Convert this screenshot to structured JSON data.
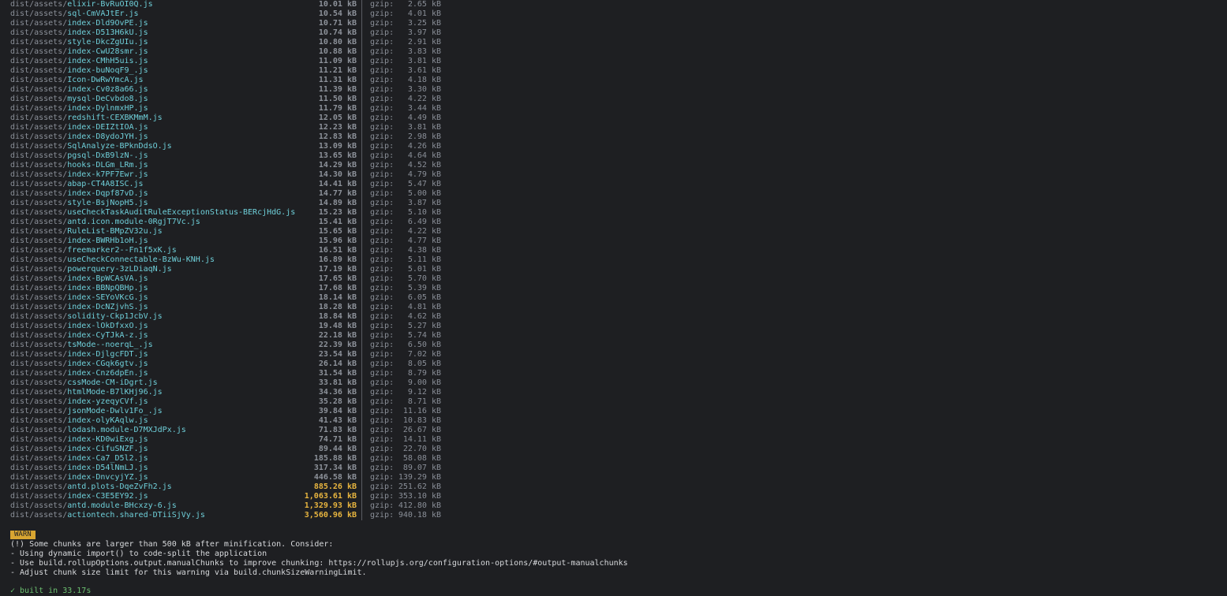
{
  "rows": [
    {
      "dir": "dist/assets/",
      "file": "elixir-BvRuOI0Q.js",
      "size": "10.01 kB",
      "gzip_label": "gzip:",
      "gzip": "2.65 kB"
    },
    {
      "dir": "dist/assets/",
      "file": "sql-CmVAJtEr.js",
      "size": "10.54 kB",
      "gzip_label": "gzip:",
      "gzip": "4.01 kB"
    },
    {
      "dir": "dist/assets/",
      "file": "index-Dld9OvPE.js",
      "size": "10.71 kB",
      "gzip_label": "gzip:",
      "gzip": "3.25 kB"
    },
    {
      "dir": "dist/assets/",
      "file": "index-D513H6kU.js",
      "size": "10.74 kB",
      "gzip_label": "gzip:",
      "gzip": "3.97 kB"
    },
    {
      "dir": "dist/assets/",
      "file": "style-DkcZgUIu.js",
      "size": "10.80 kB",
      "gzip_label": "gzip:",
      "gzip": "2.91 kB"
    },
    {
      "dir": "dist/assets/",
      "file": "index-CwU28smr.js",
      "size": "10.88 kB",
      "gzip_label": "gzip:",
      "gzip": "3.83 kB"
    },
    {
      "dir": "dist/assets/",
      "file": "index-CMhH5uis.js",
      "size": "11.09 kB",
      "gzip_label": "gzip:",
      "gzip": "3.81 kB"
    },
    {
      "dir": "dist/assets/",
      "file": "index-buNoqF9_.js",
      "size": "11.21 kB",
      "gzip_label": "gzip:",
      "gzip": "3.61 kB"
    },
    {
      "dir": "dist/assets/",
      "file": "Icon-DwRwYmcA.js",
      "size": "11.31 kB",
      "gzip_label": "gzip:",
      "gzip": "4.18 kB"
    },
    {
      "dir": "dist/assets/",
      "file": "index-Cv0z8a66.js",
      "size": "11.39 kB",
      "gzip_label": "gzip:",
      "gzip": "3.30 kB"
    },
    {
      "dir": "dist/assets/",
      "file": "mysql-DeCvbdo8.js",
      "size": "11.50 kB",
      "gzip_label": "gzip:",
      "gzip": "4.22 kB"
    },
    {
      "dir": "dist/assets/",
      "file": "index-DylnmxHP.js",
      "size": "11.79 kB",
      "gzip_label": "gzip:",
      "gzip": "3.44 kB"
    },
    {
      "dir": "dist/assets/",
      "file": "redshift-CEXBKMmM.js",
      "size": "12.05 kB",
      "gzip_label": "gzip:",
      "gzip": "4.49 kB"
    },
    {
      "dir": "dist/assets/",
      "file": "index-DEIZtIOA.js",
      "size": "12.23 kB",
      "gzip_label": "gzip:",
      "gzip": "3.81 kB"
    },
    {
      "dir": "dist/assets/",
      "file": "index-D8ydoJYH.js",
      "size": "12.83 kB",
      "gzip_label": "gzip:",
      "gzip": "2.98 kB"
    },
    {
      "dir": "dist/assets/",
      "file": "SqlAnalyze-BPknDdsO.js",
      "size": "13.09 kB",
      "gzip_label": "gzip:",
      "gzip": "4.26 kB"
    },
    {
      "dir": "dist/assets/",
      "file": "pgsql-DxB9lzN-.js",
      "size": "13.65 kB",
      "gzip_label": "gzip:",
      "gzip": "4.64 kB"
    },
    {
      "dir": "dist/assets/",
      "file": "hooks-DLGm_LRm.js",
      "size": "14.29 kB",
      "gzip_label": "gzip:",
      "gzip": "4.52 kB"
    },
    {
      "dir": "dist/assets/",
      "file": "index-k7PF7Ewr.js",
      "size": "14.30 kB",
      "gzip_label": "gzip:",
      "gzip": "4.79 kB"
    },
    {
      "dir": "dist/assets/",
      "file": "abap-CT4A8ISC.js",
      "size": "14.41 kB",
      "gzip_label": "gzip:",
      "gzip": "5.47 kB"
    },
    {
      "dir": "dist/assets/",
      "file": "index-Dqpf87vD.js",
      "size": "14.77 kB",
      "gzip_label": "gzip:",
      "gzip": "5.00 kB"
    },
    {
      "dir": "dist/assets/",
      "file": "style-BsjNopH5.js",
      "size": "14.89 kB",
      "gzip_label": "gzip:",
      "gzip": "3.87 kB"
    },
    {
      "dir": "dist/assets/",
      "file": "useCheckTaskAuditRuleExceptionStatus-BERcjHdG.js",
      "size": "15.23 kB",
      "gzip_label": "gzip:",
      "gzip": "5.10 kB"
    },
    {
      "dir": "dist/assets/",
      "file": "antd.icon.module-0RgjT7Vc.js",
      "size": "15.41 kB",
      "gzip_label": "gzip:",
      "gzip": "6.49 kB"
    },
    {
      "dir": "dist/assets/",
      "file": "RuleList-BMpZV32u.js",
      "size": "15.65 kB",
      "gzip_label": "gzip:",
      "gzip": "4.22 kB"
    },
    {
      "dir": "dist/assets/",
      "file": "index-BWRHb1oH.js",
      "size": "15.96 kB",
      "gzip_label": "gzip:",
      "gzip": "4.77 kB"
    },
    {
      "dir": "dist/assets/",
      "file": "freemarker2--Fn1f5xK.js",
      "size": "16.51 kB",
      "gzip_label": "gzip:",
      "gzip": "4.38 kB"
    },
    {
      "dir": "dist/assets/",
      "file": "useCheckConnectable-BzWu-KNH.js",
      "size": "16.89 kB",
      "gzip_label": "gzip:",
      "gzip": "5.11 kB"
    },
    {
      "dir": "dist/assets/",
      "file": "powerquery-3zLDiaqN.js",
      "size": "17.19 kB",
      "gzip_label": "gzip:",
      "gzip": "5.01 kB"
    },
    {
      "dir": "dist/assets/",
      "file": "index-BpWCAsVA.js",
      "size": "17.65 kB",
      "gzip_label": "gzip:",
      "gzip": "5.70 kB"
    },
    {
      "dir": "dist/assets/",
      "file": "index-BBNpQBHp.js",
      "size": "17.68 kB",
      "gzip_label": "gzip:",
      "gzip": "5.39 kB"
    },
    {
      "dir": "dist/assets/",
      "file": "index-SEYoVKcG.js",
      "size": "18.14 kB",
      "gzip_label": "gzip:",
      "gzip": "6.05 kB"
    },
    {
      "dir": "dist/assets/",
      "file": "index-DcNZjvhS.js",
      "size": "18.28 kB",
      "gzip_label": "gzip:",
      "gzip": "4.81 kB"
    },
    {
      "dir": "dist/assets/",
      "file": "solidity-Ckp1JcbV.js",
      "size": "18.84 kB",
      "gzip_label": "gzip:",
      "gzip": "4.62 kB"
    },
    {
      "dir": "dist/assets/",
      "file": "index-lOkDfxxO.js",
      "size": "19.48 kB",
      "gzip_label": "gzip:",
      "gzip": "5.27 kB"
    },
    {
      "dir": "dist/assets/",
      "file": "index-CyTJkA-z.js",
      "size": "22.18 kB",
      "gzip_label": "gzip:",
      "gzip": "5.74 kB"
    },
    {
      "dir": "dist/assets/",
      "file": "tsMode--noerqL_.js",
      "size": "22.39 kB",
      "gzip_label": "gzip:",
      "gzip": "6.50 kB"
    },
    {
      "dir": "dist/assets/",
      "file": "index-DjlgcFDT.js",
      "size": "23.54 kB",
      "gzip_label": "gzip:",
      "gzip": "7.02 kB"
    },
    {
      "dir": "dist/assets/",
      "file": "index-CGqk6gtv.js",
      "size": "26.14 kB",
      "gzip_label": "gzip:",
      "gzip": "8.05 kB"
    },
    {
      "dir": "dist/assets/",
      "file": "index-Cnz6dpEn.js",
      "size": "31.54 kB",
      "gzip_label": "gzip:",
      "gzip": "8.79 kB"
    },
    {
      "dir": "dist/assets/",
      "file": "cssMode-CM-iDgrt.js",
      "size": "33.81 kB",
      "gzip_label": "gzip:",
      "gzip": "9.00 kB"
    },
    {
      "dir": "dist/assets/",
      "file": "htmlMode-B7lKHj96.js",
      "size": "34.36 kB",
      "gzip_label": "gzip:",
      "gzip": "9.12 kB"
    },
    {
      "dir": "dist/assets/",
      "file": "index-yzeqyCVf.js",
      "size": "35.28 kB",
      "gzip_label": "gzip:",
      "gzip": "8.71 kB"
    },
    {
      "dir": "dist/assets/",
      "file": "jsonMode-Dwlv1Fo_.js",
      "size": "39.84 kB",
      "gzip_label": "gzip:",
      "gzip": "11.16 kB"
    },
    {
      "dir": "dist/assets/",
      "file": "index-olyKAqlw.js",
      "size": "41.43 kB",
      "gzip_label": "gzip:",
      "gzip": "10.83 kB"
    },
    {
      "dir": "dist/assets/",
      "file": "lodash.module-D7MXJdPx.js",
      "size": "71.83 kB",
      "gzip_label": "gzip:",
      "gzip": "26.67 kB"
    },
    {
      "dir": "dist/assets/",
      "file": "index-KD0wiExg.js",
      "size": "74.71 kB",
      "gzip_label": "gzip:",
      "gzip": "14.11 kB"
    },
    {
      "dir": "dist/assets/",
      "file": "index-CifuSNZF.js",
      "size": "89.44 kB",
      "gzip_label": "gzip:",
      "gzip": "22.70 kB"
    },
    {
      "dir": "dist/assets/",
      "file": "index-Ca7_D5l2.js",
      "size": "185.88 kB",
      "gzip_label": "gzip:",
      "gzip": "58.08 kB"
    },
    {
      "dir": "dist/assets/",
      "file": "index-D54lNmLJ.js",
      "size": "317.34 kB",
      "gzip_label": "gzip:",
      "gzip": "89.07 kB"
    },
    {
      "dir": "dist/assets/",
      "file": "index-DnvcyjYZ.js",
      "size": "446.58 kB",
      "gzip_label": "gzip:",
      "gzip": "139.29 kB"
    },
    {
      "dir": "dist/assets/",
      "file": "antd.plots-DqeZvFh2.js",
      "size": "885.26 kB",
      "gzip_label": "gzip:",
      "gzip": "251.62 kB",
      "big": true
    },
    {
      "dir": "dist/assets/",
      "file": "index-C3E5EY92.js",
      "size": "1,063.61 kB",
      "gzip_label": "gzip:",
      "gzip": "353.10 kB",
      "big": true
    },
    {
      "dir": "dist/assets/",
      "file": "antd.module-BHcxzy-6.js",
      "size": "1,329.93 kB",
      "gzip_label": "gzip:",
      "gzip": "412.80 kB",
      "big": true
    },
    {
      "dir": "dist/assets/",
      "file": "actiontech.shared-DTiiSjVy.js",
      "size": "3,560.96 kB",
      "gzip_label": "gzip:",
      "gzip": "940.18 kB",
      "big": true
    }
  ],
  "warning": {
    "badge": " WARN ",
    "lines": [
      "(!) Some chunks are larger than 500 kB after minification. Consider:",
      "- Using dynamic import() to code-split the application",
      "- Use build.rollupOptions.output.manualChunks to improve chunking: https://rollupjs.org/configuration-options/#output-manualchunks",
      "- Adjust chunk size limit for this warning via build.chunkSizeWarningLimit."
    ]
  },
  "built": "✓ built in 33.17s",
  "colors": {
    "background": "#1e1f22",
    "filename": "#6fd0da",
    "large_size": "#e8b53f",
    "warn_badge": "#d8a531",
    "success": "#6cc070"
  }
}
